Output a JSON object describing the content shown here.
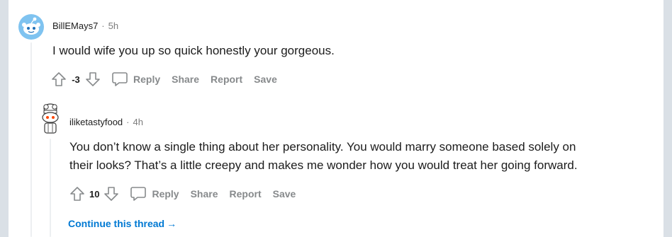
{
  "comments": [
    {
      "username": "BillEMays7",
      "separator": "·",
      "time": "5h",
      "body": "I would wife you up so quick honestly your gorgeous.",
      "score": "-3",
      "actions": {
        "reply": "Reply",
        "share": "Share",
        "report": "Report",
        "save": "Save"
      }
    },
    {
      "username": "iliketastyfood",
      "separator": "·",
      "time": "4h",
      "body_lines": [
        "You don’t know a single thing about her personality. You would marry someone based solely on",
        "their looks? That’s a little creepy and makes me wonder how you would treat her going forward."
      ],
      "score": "10",
      "actions": {
        "reply": "Reply",
        "share": "Share",
        "report": "Report",
        "save": "Save"
      }
    }
  ],
  "continue_thread": {
    "label": "Continue this thread",
    "arrow": "→"
  },
  "icons": {
    "upvote": "upvote-arrow-icon",
    "downvote": "downvote-arrow-icon",
    "reply": "speech-bubble-icon",
    "avatar1": "snoo-avatar-icon",
    "avatar2": "snoo-avatar-icon"
  },
  "colors": {
    "link": "#0079d3",
    "meta": "#7c7c7c",
    "action": "#878a8c",
    "background": "#dae0e6"
  }
}
